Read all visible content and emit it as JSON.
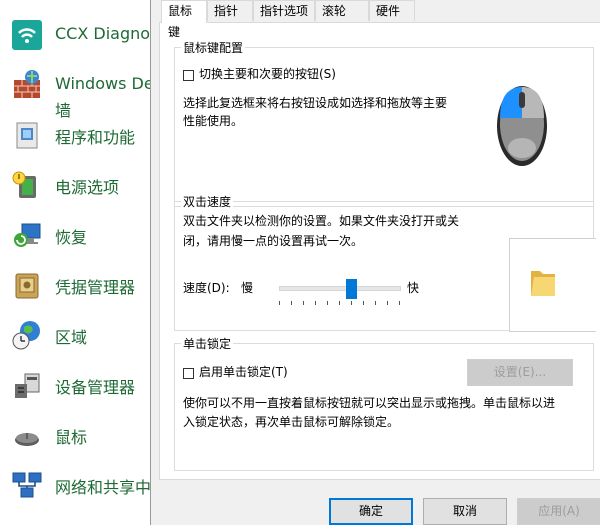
{
  "control_panel": {
    "items": [
      {
        "label": "CCX Diagno",
        "icon": "wifi-icon"
      },
      {
        "label": "Windows De",
        "label2": "墙",
        "icon": "firewall-icon"
      },
      {
        "label": "程序和功能",
        "icon": "programs-icon"
      },
      {
        "label": "电源选项",
        "icon": "power-icon"
      },
      {
        "label": "恢复",
        "icon": "recovery-icon"
      },
      {
        "label": "凭据管理器",
        "icon": "credential-icon"
      },
      {
        "label": "区域",
        "icon": "region-icon"
      },
      {
        "label": "设备管理器",
        "icon": "device-manager-icon"
      },
      {
        "label": "鼠标",
        "icon": "mouse-icon"
      },
      {
        "label": "网络和共享中",
        "icon": "network-icon"
      }
    ]
  },
  "dialog": {
    "tabs": [
      "鼠标键",
      "指针",
      "指针选项",
      "滚轮",
      "硬件"
    ],
    "selected_tab": "鼠标键",
    "button_config": {
      "title": "鼠标键配置",
      "swap_label": "切换主要和次要的按钮(S)",
      "swap_checked": false,
      "description_line1": "选择此复选框来将右按钮设成如选择和拖放等主要",
      "description_line2": "性能使用。"
    },
    "double_click": {
      "title": "双击速度",
      "description_line1": "双击文件夹以检测你的设置。如果文件夹没打开或关",
      "description_line2": "闭，请用慢一点的设置再试一次。",
      "speed_label": "速度(D):",
      "slow_label": "慢",
      "fast_label": "快",
      "speed_level": 0.6
    },
    "click_lock": {
      "title": "单击锁定",
      "enable_label": "启用单击锁定(T)",
      "enable_checked": false,
      "settings_button": "设置(E)...",
      "description_line1": "使你可以不用一直按着鼠标按钮就可以突出显示或拖拽。单击鼠标以进",
      "description_line2": "入锁定状态，再次单击鼠标可解除锁定。"
    },
    "buttons": {
      "ok": "确定",
      "cancel": "取消",
      "apply": "应用(A)"
    },
    "accent_color": "#0078d7"
  }
}
